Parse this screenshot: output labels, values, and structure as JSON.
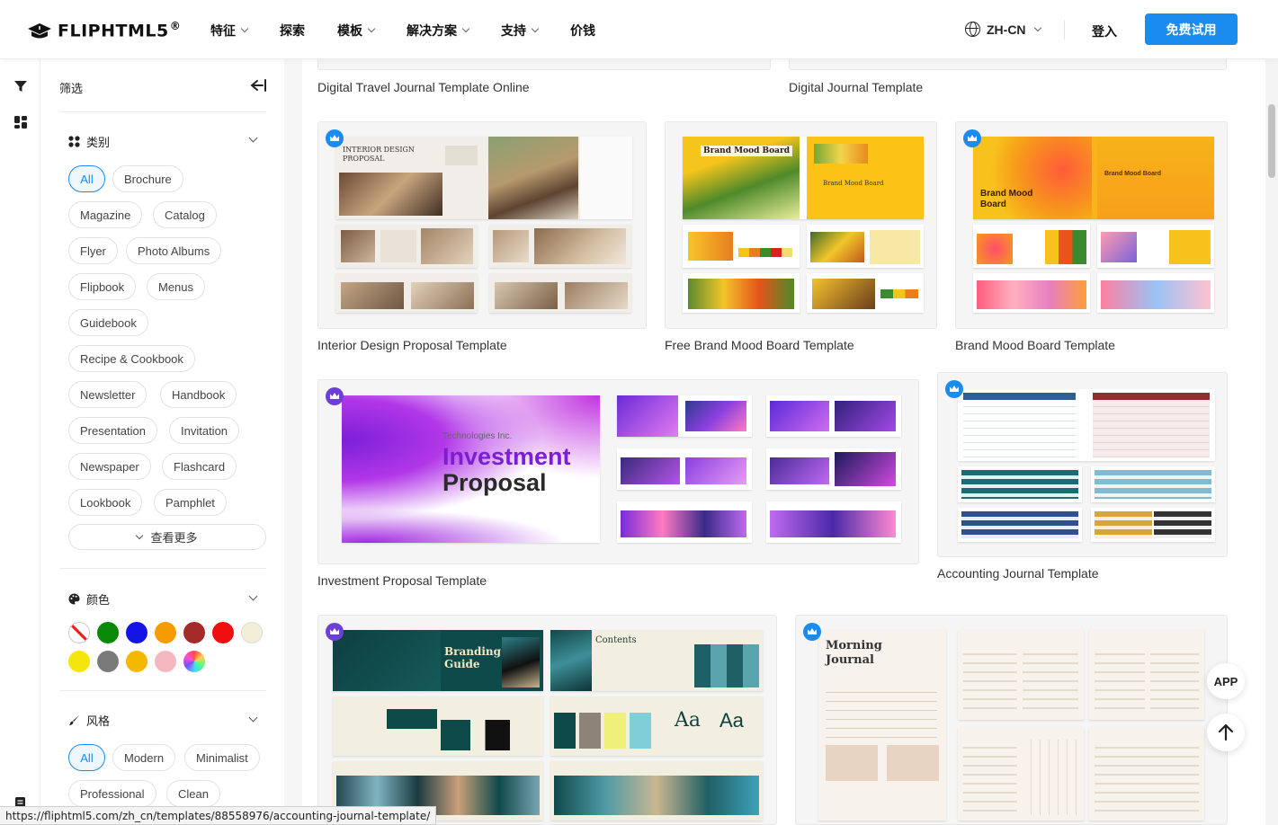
{
  "header": {
    "logo": "FLIPHTML5",
    "logo_reg": "®",
    "nav": [
      {
        "label": "特征",
        "dropdown": true
      },
      {
        "label": "探索",
        "dropdown": false
      },
      {
        "label": "模板",
        "dropdown": true
      },
      {
        "label": "解决方案",
        "dropdown": true
      },
      {
        "label": "支持",
        "dropdown": true
      },
      {
        "label": "价钱",
        "dropdown": false
      }
    ],
    "language": "ZH-CN",
    "login": "登入",
    "trial": "免费试用"
  },
  "sidebar": {
    "filter_title": "筛选",
    "category": {
      "title": "类别",
      "tags": [
        "All",
        "Brochure",
        "Magazine",
        "Catalog",
        "Flyer",
        "Photo Albums",
        "Flipbook",
        "Menus",
        "Guidebook",
        "Recipe & Cookbook",
        "Newsletter",
        "Handbook",
        "Presentation",
        "Invitation",
        "Newspaper",
        "Flashcard",
        "Lookbook",
        "Pamphlet"
      ],
      "more": "查看更多"
    },
    "color": {
      "title": "颜色",
      "swatches": [
        "none",
        "#0a8a0a",
        "#1414e6",
        "#f59c00",
        "#a52a2a",
        "#f00f0f",
        "#f2efd6",
        "#f5e60a",
        "#7a7a7a",
        "#f5b800",
        "#f5b8c0",
        "rainbow"
      ]
    },
    "style": {
      "title": "风格",
      "tags": [
        "All",
        "Modern",
        "Minimalist",
        "Professional",
        "Clean"
      ]
    }
  },
  "templates": [
    {
      "title": "Digital Travel Journal Template Online"
    },
    {
      "title": "Digital Journal Template"
    },
    {
      "title": "Interior Design Proposal Template",
      "badge": "blue",
      "cover": "INTERIOR DESIGN PROPOSAL"
    },
    {
      "title": "Free Brand Mood Board Template",
      "cover": "Brand Mood Board"
    },
    {
      "title": "Brand Mood Board Template",
      "badge": "blue",
      "cover": "Brand Mood Board"
    },
    {
      "title": "Investment Proposal Template",
      "badge": "purple",
      "cover_company": "Technologies Inc.",
      "cover_line1": "Investment",
      "cover_line2": "Proposal"
    },
    {
      "title": "Accounting Journal Template",
      "badge": "blue"
    },
    {
      "title": "",
      "badge": "purple",
      "cover_line1": "Branding",
      "cover_line2": "Guide"
    },
    {
      "title": "",
      "badge": "blue",
      "cover_line1": "Morning",
      "cover_line2": "Journal"
    }
  ],
  "floating": {
    "app": "APP"
  },
  "status_bar": "https://fliphtml5.com/zh_cn/templates/88558976/accounting-journal-template/"
}
